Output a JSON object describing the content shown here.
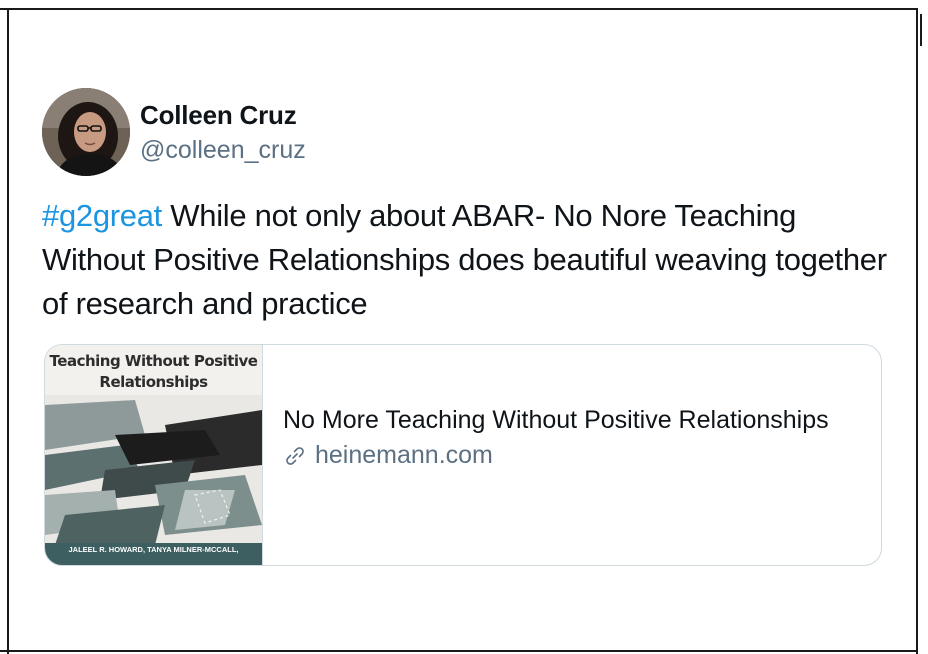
{
  "user": {
    "display_name": "Colleen Cruz",
    "handle": "@colleen_cruz"
  },
  "tweet": {
    "hashtag": "#g2great",
    "text": " While not only about ABAR- No Nore Teaching Without Positive Relationships does beautiful weaving together of research and practice"
  },
  "card": {
    "cover_title": "Teaching Without Positive Relationships",
    "cover_authors": "JALEEL R. HOWARD, TANYA MILNER-MCCALL,",
    "title": "No More Teaching Without Positive Relationships",
    "domain": "heinemann.com",
    "domain_icon": "link-icon"
  },
  "colors": {
    "hashtag": "#1b95e0",
    "secondary_text": "#5b7083",
    "border": "#cfd9de"
  }
}
